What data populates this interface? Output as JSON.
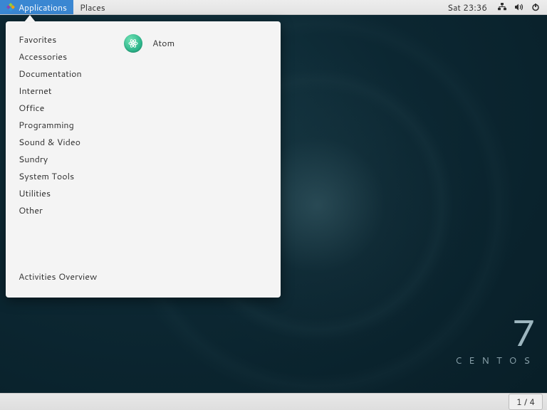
{
  "topbar": {
    "applications_label": "Applications",
    "places_label": "Places",
    "clock": "Sat 23:36"
  },
  "menu": {
    "categories": [
      "Favorites",
      "Accessories",
      "Documentation",
      "Internet",
      "Office",
      "Programming",
      "Sound & Video",
      "Sundry",
      "System Tools",
      "Utilities",
      "Other"
    ],
    "activities_label": "Activities Overview",
    "apps": [
      {
        "name": "Atom"
      }
    ]
  },
  "branding": {
    "version": "7",
    "name": "CENTOS"
  },
  "bottombar": {
    "workspace": "1 / 4"
  }
}
